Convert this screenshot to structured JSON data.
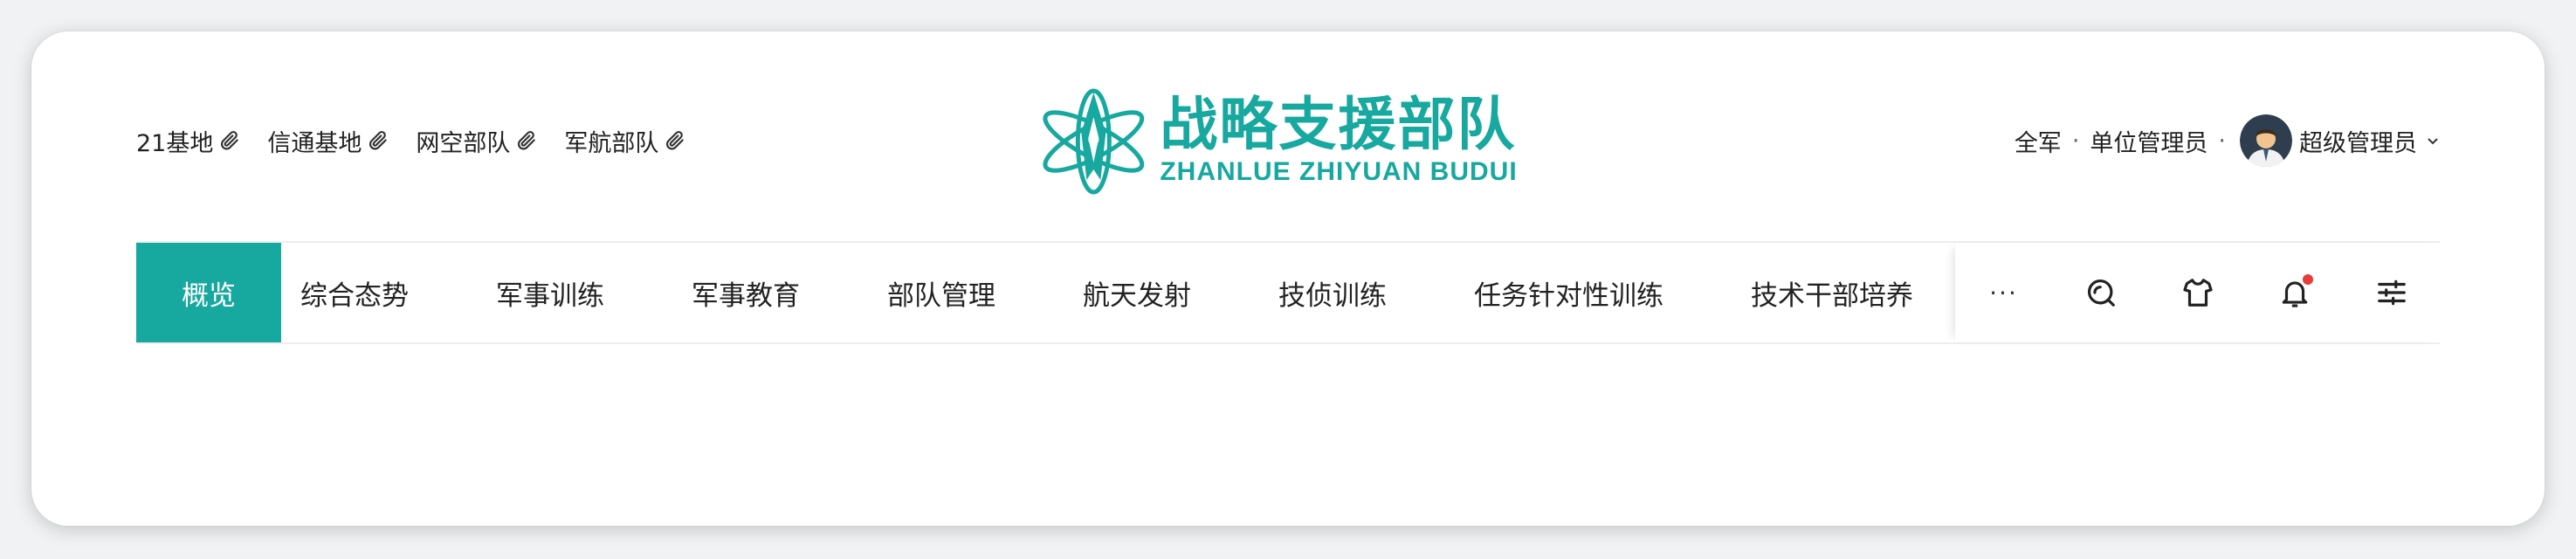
{
  "quick_links": [
    {
      "label": "21基地",
      "icon": "paperclip-icon"
    },
    {
      "label": "信通基地",
      "icon": "paperclip-icon"
    },
    {
      "label": "网空部队",
      "icon": "paperclip-icon"
    },
    {
      "label": "军航部队",
      "icon": "paperclip-icon"
    }
  ],
  "logo": {
    "title_cn": "战略支援部队",
    "title_en": "ZHANLUE ZHIYUAN BUDUI",
    "color": "#17a89f"
  },
  "user": {
    "scope": "全军",
    "role": "单位管理员",
    "name": "超级管理员",
    "sep": "·"
  },
  "nav": {
    "tabs": [
      {
        "label": "概览",
        "active": true
      },
      {
        "label": "综合态势"
      },
      {
        "label": "军事训练"
      },
      {
        "label": "军事教育"
      },
      {
        "label": "部队管理"
      },
      {
        "label": "航天发射"
      },
      {
        "label": "技侦训练"
      },
      {
        "label": "任务针对性训练"
      },
      {
        "label": "技术干部培养"
      }
    ],
    "more": "···",
    "tools": [
      "search-icon",
      "shirt-icon",
      "bell-icon",
      "sliders-icon"
    ],
    "accent": "#17a89f",
    "notification_color": "#ea3b3b"
  }
}
